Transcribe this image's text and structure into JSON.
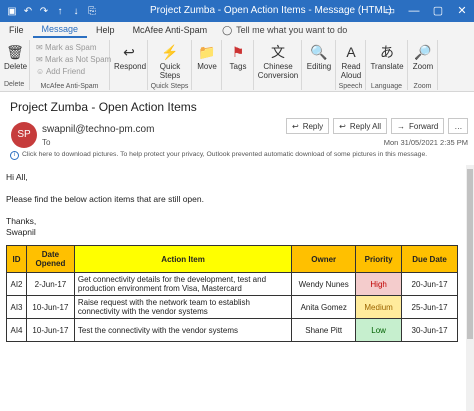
{
  "titlebar": {
    "title": "Project Zumba - Open Action Items  -  Message (HTML)",
    "qat": [
      "▣",
      "↶",
      "↷",
      "↑",
      "↓",
      "⎘"
    ],
    "controls": [
      "▭",
      "—",
      "▢",
      "✕"
    ]
  },
  "tabs": {
    "file": "File",
    "message": "Message",
    "help": "Help",
    "mcafee": "McAfee Anti-Spam",
    "tell": "Tell me what you want to do"
  },
  "ribbon": {
    "delete": "Delete",
    "delete_group": "Delete",
    "mark_spam": "Mark as Spam",
    "mark_not_spam": "Mark as Not Spam",
    "add_friend": "Add Friend",
    "mcafee_group": "McAfee Anti-Spam",
    "respond": "Respond",
    "quick_steps": "Quick Steps",
    "quick_steps_group": "Quick Steps",
    "move": "Move",
    "tags": "Tags",
    "chinese": "Chinese Conversion",
    "editing": "Editing",
    "read_aloud": "Read Aloud",
    "speech_group": "Speech",
    "translate": "Translate",
    "language_group": "Language",
    "zoom": "Zoom",
    "zoom_group": "Zoom"
  },
  "message": {
    "subject": "Project Zumba - Open Action Items",
    "avatar_initials": "SP",
    "sender": "swapnil@techno-pm.com",
    "to_label": "To",
    "reply": "Reply",
    "reply_all": "Reply All",
    "forward": "Forward",
    "date": "Mon 31/05/2021 2:35 PM",
    "infobar": "Click here to download pictures. To help protect your privacy, Outlook prevented automatic download of some pictures in this message.",
    "greeting": "Hi All,",
    "body_line": "Please find the below action items that are still open.",
    "thanks": "Thanks,",
    "signature": "Swapnil"
  },
  "table": {
    "headers": {
      "id": "ID",
      "date": "Date Opened",
      "item": "Action Item",
      "owner": "Owner",
      "priority": "Priority",
      "due": "Due Date"
    },
    "rows": [
      {
        "id": "AI2",
        "date": "2-Jun-17",
        "item": "Get connectivity details for the development, test and production environment from Visa, Mastercard",
        "owner": "Wendy Nunes",
        "priority": "High",
        "due": "20-Jun-17"
      },
      {
        "id": "AI3",
        "date": "10-Jun-17",
        "item": "Raise request with the network team to establish connectivity with the  vendor systems",
        "owner": "Anita Gomez",
        "priority": "Medium",
        "due": "25-Jun-17"
      },
      {
        "id": "AI4",
        "date": "10-Jun-17",
        "item": "Test the connectivity with the vendor systems",
        "owner": "Shane Pitt",
        "priority": "Low",
        "due": "30-Jun-17"
      }
    ]
  },
  "colors": {
    "title_bar": "#2b6fc1",
    "header_orange": "#ffc000",
    "header_yellow": "#ffff00",
    "high": "#f4cccc",
    "medium": "#ffeb9c",
    "low": "#c6efce"
  }
}
